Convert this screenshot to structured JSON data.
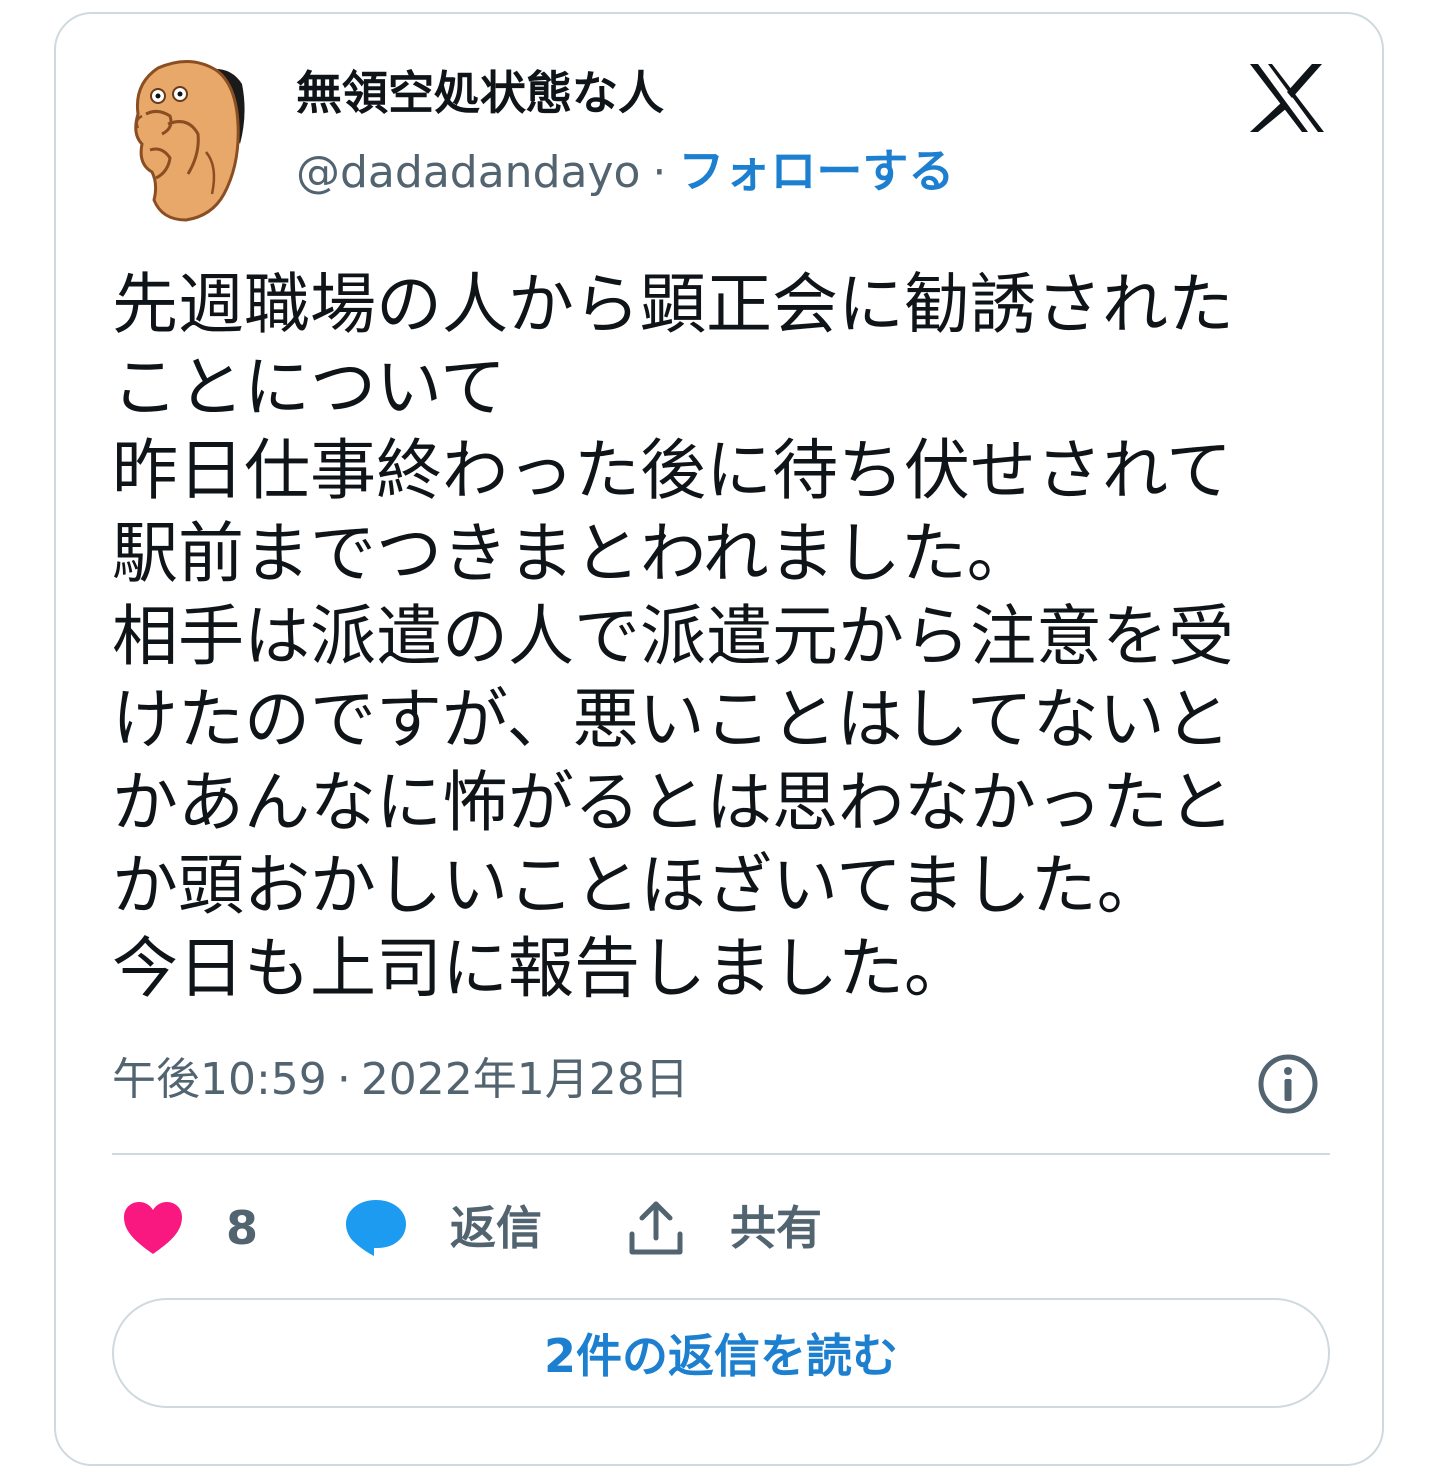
{
  "user": {
    "display_name": "無領空処状態な人",
    "handle": "@dadadandayo",
    "separator": "·",
    "follow_label": "フォローする"
  },
  "tweet": {
    "lines": [
      "先週職場の人から顕正会に勧誘された",
      "ことについて",
      "昨日仕事終わった後に待ち伏せされて",
      "駅前までつきまとわれました。",
      "相手は派遣の人で派遣元から注意を受",
      "けたのですが、悪いことはしてないと",
      "かあんなに怖がるとは思わなかったと",
      "か頭おかしいことほざいてました。",
      "今日も上司に報告しました。"
    ]
  },
  "meta": {
    "time": "午後10:59",
    "separator": "·",
    "date": "2022年1月28日"
  },
  "actions": {
    "like_count": "8",
    "reply_label": "返信",
    "share_label": "共有"
  },
  "read_replies_label": "2件の返信を読む",
  "colors": {
    "accent": "#1d7fcf",
    "like": "#f91880",
    "reply": "#1d9bf0",
    "muted": "#536471",
    "border": "#cfd9de"
  },
  "icons": {
    "brand": "x-logo-icon",
    "info": "info-icon",
    "like": "heart-icon",
    "reply": "speech-bubble-icon",
    "share": "share-upload-icon"
  }
}
